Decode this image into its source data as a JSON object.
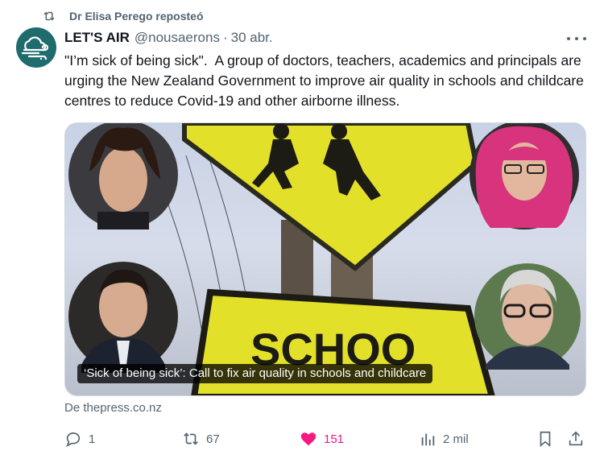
{
  "repost": {
    "label": "Dr Elisa Perego reposteó",
    "icon": "repost-icon"
  },
  "author": {
    "name": "LET'S AIR",
    "handle": "@nousaerons",
    "separator": "·",
    "date": "30 abr.",
    "avatar_icon": "wind-cloud-icon",
    "avatar_color": "#1f6b6e"
  },
  "tweet": {
    "text": "\"I’m sick of being sick\".  A group of doctors, teachers, academics and principals are urging the New Zealand Government to improve air quality in schools and childcare centres to reduce Covid-19 and other airborne illness."
  },
  "card": {
    "caption": "‘Sick of being sick’: Call to fix air quality in schools and childcare",
    "source": "De thepress.co.nz",
    "sign_text": "SCHOO"
  },
  "actions": {
    "replies": "1",
    "reposts": "67",
    "likes": "151",
    "views": "2 mil"
  },
  "colors": {
    "secondary_text": "#536471",
    "like": "#f91880",
    "sign_yellow": "#e3e02a"
  }
}
